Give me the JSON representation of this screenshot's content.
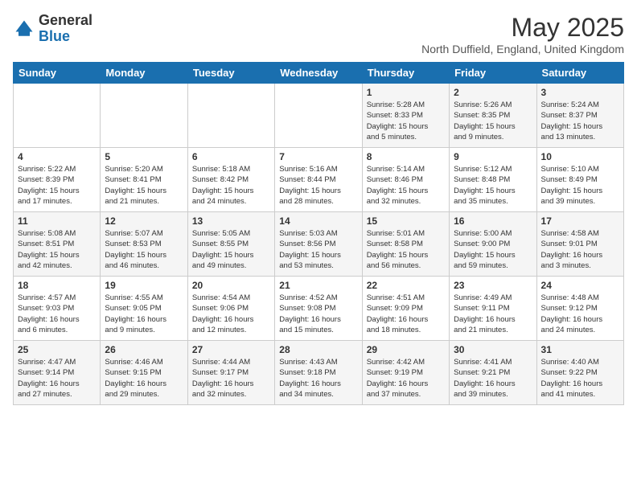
{
  "logo": {
    "general": "General",
    "blue": "Blue"
  },
  "title": "May 2025",
  "subtitle": "North Duffield, England, United Kingdom",
  "days_of_week": [
    "Sunday",
    "Monday",
    "Tuesday",
    "Wednesday",
    "Thursday",
    "Friday",
    "Saturday"
  ],
  "weeks": [
    [
      {
        "day": "",
        "info": ""
      },
      {
        "day": "",
        "info": ""
      },
      {
        "day": "",
        "info": ""
      },
      {
        "day": "",
        "info": ""
      },
      {
        "day": "1",
        "info": "Sunrise: 5:28 AM\nSunset: 8:33 PM\nDaylight: 15 hours\nand 5 minutes."
      },
      {
        "day": "2",
        "info": "Sunrise: 5:26 AM\nSunset: 8:35 PM\nDaylight: 15 hours\nand 9 minutes."
      },
      {
        "day": "3",
        "info": "Sunrise: 5:24 AM\nSunset: 8:37 PM\nDaylight: 15 hours\nand 13 minutes."
      }
    ],
    [
      {
        "day": "4",
        "info": "Sunrise: 5:22 AM\nSunset: 8:39 PM\nDaylight: 15 hours\nand 17 minutes."
      },
      {
        "day": "5",
        "info": "Sunrise: 5:20 AM\nSunset: 8:41 PM\nDaylight: 15 hours\nand 21 minutes."
      },
      {
        "day": "6",
        "info": "Sunrise: 5:18 AM\nSunset: 8:42 PM\nDaylight: 15 hours\nand 24 minutes."
      },
      {
        "day": "7",
        "info": "Sunrise: 5:16 AM\nSunset: 8:44 PM\nDaylight: 15 hours\nand 28 minutes."
      },
      {
        "day": "8",
        "info": "Sunrise: 5:14 AM\nSunset: 8:46 PM\nDaylight: 15 hours\nand 32 minutes."
      },
      {
        "day": "9",
        "info": "Sunrise: 5:12 AM\nSunset: 8:48 PM\nDaylight: 15 hours\nand 35 minutes."
      },
      {
        "day": "10",
        "info": "Sunrise: 5:10 AM\nSunset: 8:49 PM\nDaylight: 15 hours\nand 39 minutes."
      }
    ],
    [
      {
        "day": "11",
        "info": "Sunrise: 5:08 AM\nSunset: 8:51 PM\nDaylight: 15 hours\nand 42 minutes."
      },
      {
        "day": "12",
        "info": "Sunrise: 5:07 AM\nSunset: 8:53 PM\nDaylight: 15 hours\nand 46 minutes."
      },
      {
        "day": "13",
        "info": "Sunrise: 5:05 AM\nSunset: 8:55 PM\nDaylight: 15 hours\nand 49 minutes."
      },
      {
        "day": "14",
        "info": "Sunrise: 5:03 AM\nSunset: 8:56 PM\nDaylight: 15 hours\nand 53 minutes."
      },
      {
        "day": "15",
        "info": "Sunrise: 5:01 AM\nSunset: 8:58 PM\nDaylight: 15 hours\nand 56 minutes."
      },
      {
        "day": "16",
        "info": "Sunrise: 5:00 AM\nSunset: 9:00 PM\nDaylight: 15 hours\nand 59 minutes."
      },
      {
        "day": "17",
        "info": "Sunrise: 4:58 AM\nSunset: 9:01 PM\nDaylight: 16 hours\nand 3 minutes."
      }
    ],
    [
      {
        "day": "18",
        "info": "Sunrise: 4:57 AM\nSunset: 9:03 PM\nDaylight: 16 hours\nand 6 minutes."
      },
      {
        "day": "19",
        "info": "Sunrise: 4:55 AM\nSunset: 9:05 PM\nDaylight: 16 hours\nand 9 minutes."
      },
      {
        "day": "20",
        "info": "Sunrise: 4:54 AM\nSunset: 9:06 PM\nDaylight: 16 hours\nand 12 minutes."
      },
      {
        "day": "21",
        "info": "Sunrise: 4:52 AM\nSunset: 9:08 PM\nDaylight: 16 hours\nand 15 minutes."
      },
      {
        "day": "22",
        "info": "Sunrise: 4:51 AM\nSunset: 9:09 PM\nDaylight: 16 hours\nand 18 minutes."
      },
      {
        "day": "23",
        "info": "Sunrise: 4:49 AM\nSunset: 9:11 PM\nDaylight: 16 hours\nand 21 minutes."
      },
      {
        "day": "24",
        "info": "Sunrise: 4:48 AM\nSunset: 9:12 PM\nDaylight: 16 hours\nand 24 minutes."
      }
    ],
    [
      {
        "day": "25",
        "info": "Sunrise: 4:47 AM\nSunset: 9:14 PM\nDaylight: 16 hours\nand 27 minutes."
      },
      {
        "day": "26",
        "info": "Sunrise: 4:46 AM\nSunset: 9:15 PM\nDaylight: 16 hours\nand 29 minutes."
      },
      {
        "day": "27",
        "info": "Sunrise: 4:44 AM\nSunset: 9:17 PM\nDaylight: 16 hours\nand 32 minutes."
      },
      {
        "day": "28",
        "info": "Sunrise: 4:43 AM\nSunset: 9:18 PM\nDaylight: 16 hours\nand 34 minutes."
      },
      {
        "day": "29",
        "info": "Sunrise: 4:42 AM\nSunset: 9:19 PM\nDaylight: 16 hours\nand 37 minutes."
      },
      {
        "day": "30",
        "info": "Sunrise: 4:41 AM\nSunset: 9:21 PM\nDaylight: 16 hours\nand 39 minutes."
      },
      {
        "day": "31",
        "info": "Sunrise: 4:40 AM\nSunset: 9:22 PM\nDaylight: 16 hours\nand 41 minutes."
      }
    ]
  ]
}
